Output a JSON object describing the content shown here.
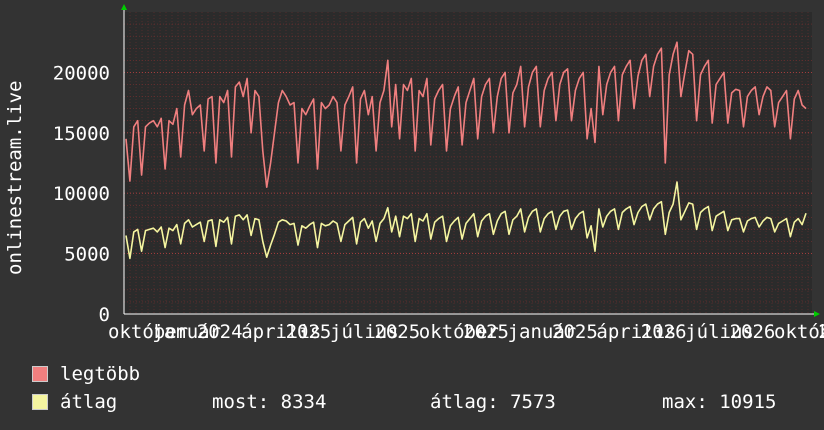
{
  "chart_data": {
    "type": "line",
    "ylabel": "onlinestream.live",
    "ylim": [
      0,
      25000
    ],
    "yticks": [
      0,
      5000,
      10000,
      15000,
      20000
    ],
    "xticks": [
      "október",
      "január",
      "2024",
      "április",
      "2025",
      "július",
      "2025",
      "október",
      "2025",
      "január",
      "2025",
      "április",
      "2026",
      "július",
      "2026",
      "október",
      "20"
    ],
    "grid": true,
    "colors": {
      "background": "#333333",
      "plot": "#2b2b2b",
      "grid": "#7a3030",
      "axis": "#ffffff",
      "arrow": "#00cc00"
    },
    "series": [
      {
        "name": "legtöbb",
        "color": "#f07f7f",
        "values": [
          14500,
          11000,
          15500,
          16000,
          11500,
          15500,
          15800,
          16000,
          15500,
          16200,
          12000,
          16000,
          15700,
          17000,
          13000,
          17300,
          18500,
          16500,
          17000,
          17300,
          13500,
          17800,
          18000,
          12500,
          18000,
          17500,
          18500,
          13000,
          18800,
          19200,
          18000,
          19500,
          15000,
          18500,
          18000,
          13500,
          10500,
          12500,
          15000,
          17500,
          18500,
          18000,
          17300,
          17500,
          12500,
          17000,
          16500,
          17200,
          17800,
          12000,
          17500,
          17000,
          17300,
          18000,
          17500,
          13500,
          17300,
          18000,
          18800,
          12500,
          17800,
          18500,
          16500,
          18000,
          13500,
          17500,
          18500,
          21000,
          15500,
          19000,
          14500,
          19000,
          18500,
          19500,
          13500,
          18500,
          18000,
          19500,
          14000,
          17800,
          18500,
          19000,
          13500,
          17000,
          18000,
          18800,
          14000,
          17500,
          18500,
          19500,
          14500,
          18000,
          19000,
          19500,
          15000,
          18000,
          19500,
          20000,
          15000,
          18300,
          19000,
          20500,
          15500,
          18800,
          20000,
          20500,
          15500,
          18500,
          19500,
          20000,
          16000,
          19000,
          20000,
          20300,
          16000,
          18500,
          19500,
          20000,
          14500,
          17000,
          14200,
          20500,
          16500,
          19000,
          20000,
          20500,
          16000,
          19800,
          20500,
          21000,
          17000,
          19700,
          21000,
          21500,
          18000,
          20500,
          21500,
          22000,
          12500,
          19800,
          21500,
          22500,
          18000,
          20000,
          21800,
          21500,
          16000,
          19800,
          20500,
          21000,
          15800,
          19000,
          19500,
          20000,
          15800,
          18300,
          18600,
          18500,
          15500,
          18000,
          18500,
          18800,
          16500,
          18000,
          18800,
          18500,
          15500,
          17500,
          18000,
          18500,
          14500,
          17800,
          18500,
          17300,
          17000
        ]
      },
      {
        "name": "átlag",
        "color": "#f5f5a0",
        "values": [
          6500,
          4600,
          6800,
          7000,
          5200,
          6900,
          7000,
          7100,
          6800,
          7200,
          5500,
          7100,
          6900,
          7400,
          5800,
          7500,
          7800,
          7200,
          7400,
          7600,
          6000,
          7700,
          7800,
          5600,
          7800,
          7600,
          8000,
          5800,
          8100,
          8200,
          7800,
          8200,
          6500,
          7900,
          7800,
          6000,
          4700,
          5700,
          6600,
          7600,
          7800,
          7700,
          7400,
          7500,
          5700,
          7300,
          7100,
          7400,
          7600,
          5500,
          7500,
          7300,
          7400,
          7700,
          7500,
          6000,
          7400,
          7700,
          8000,
          5800,
          7600,
          7900,
          7100,
          7700,
          6000,
          7500,
          7900,
          8800,
          6800,
          8100,
          6400,
          8100,
          7900,
          8300,
          6000,
          7900,
          7700,
          8300,
          6200,
          7600,
          7900,
          8100,
          6000,
          7300,
          7700,
          8000,
          6200,
          7500,
          7900,
          8300,
          6400,
          7700,
          8100,
          8300,
          6600,
          7700,
          8300,
          8500,
          6600,
          7800,
          8100,
          8700,
          6800,
          8000,
          8500,
          8700,
          6800,
          7900,
          8300,
          8500,
          7000,
          8100,
          8500,
          8600,
          7000,
          7900,
          8300,
          8500,
          6300,
          7300,
          5200,
          8700,
          7200,
          8100,
          8500,
          8700,
          7000,
          8400,
          8700,
          8900,
          7400,
          8400,
          8900,
          9100,
          7800,
          8700,
          9100,
          9300,
          6600,
          8400,
          9100,
          10915,
          7800,
          8500,
          9200,
          9100,
          7000,
          8400,
          8700,
          8900,
          6900,
          8100,
          8300,
          8500,
          6900,
          7800,
          7900,
          7900,
          6800,
          7700,
          7900,
          8000,
          7200,
          7700,
          8000,
          7900,
          6800,
          7500,
          7700,
          7900,
          6400,
          7600,
          7900,
          7400,
          8334
        ]
      }
    ]
  },
  "legend": {
    "items": [
      {
        "label": "legtöbb",
        "color": "#f07f7f"
      },
      {
        "label": "átlag",
        "color": "#f5f5a0"
      }
    ]
  },
  "stats": {
    "current": "most: 8334",
    "average": "átlag: 7573",
    "max": "max: 10915"
  }
}
